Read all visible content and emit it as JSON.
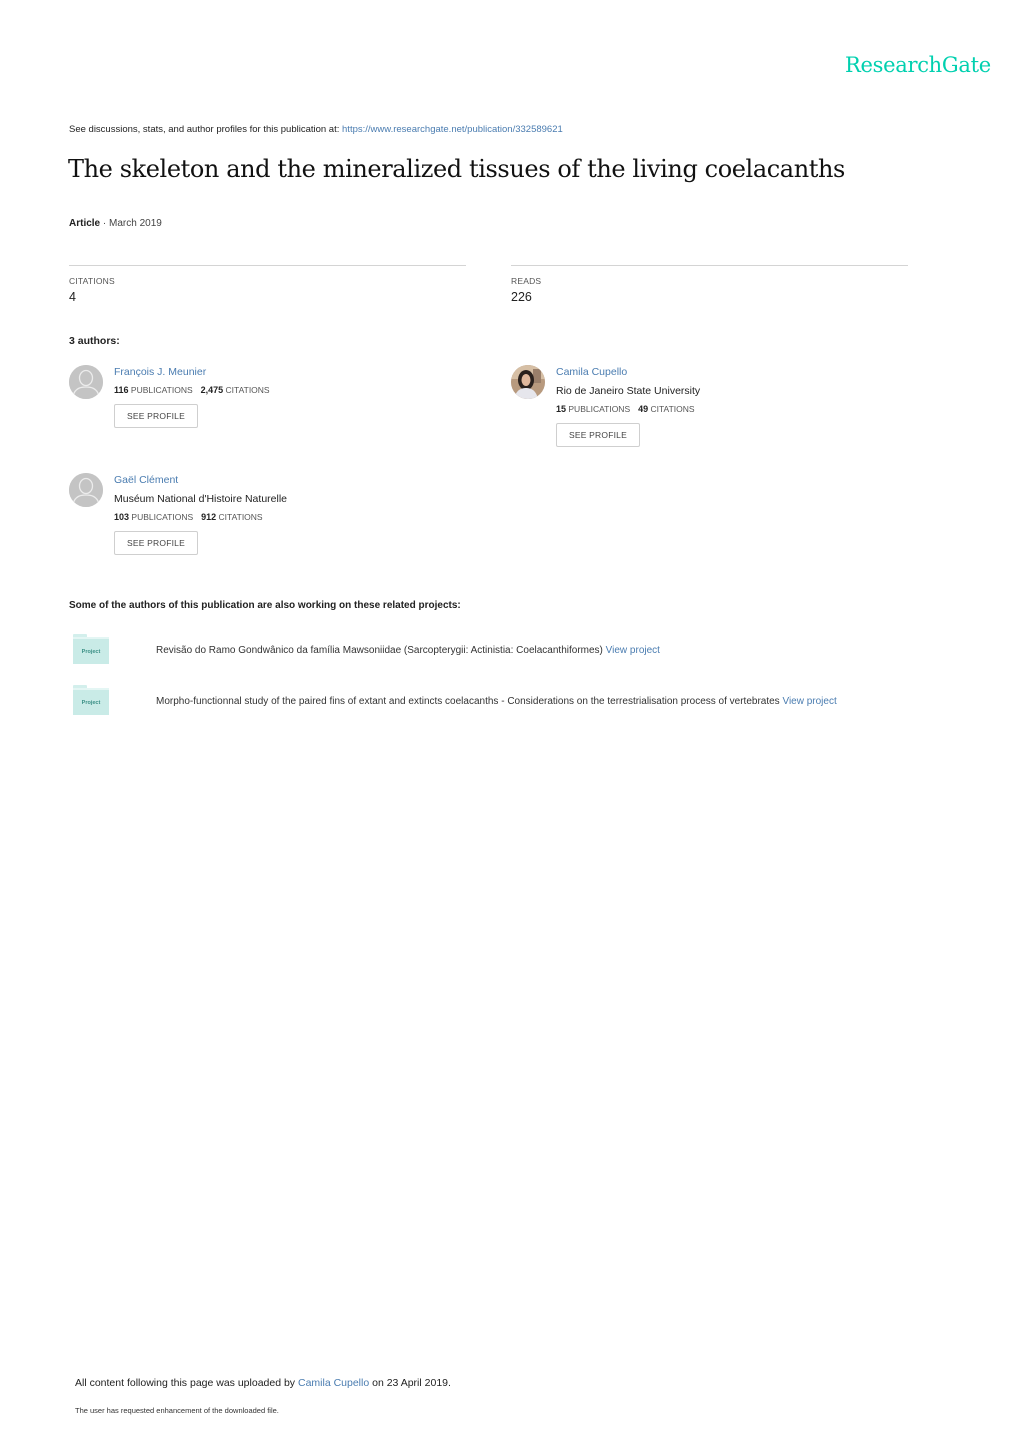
{
  "brand": {
    "logo_text": "ResearchGate",
    "logo_color": "#00d0af",
    "link_color": "#4a7cb0"
  },
  "header": {
    "discussions_prefix": "See discussions, stats, and author profiles for this publication at: ",
    "publication_url": "https://www.researchgate.net/publication/332589621"
  },
  "publication": {
    "title": "The skeleton and the mineralized tissues of the living coelacanths",
    "type": "Article",
    "separator": " · ",
    "date": "March 2019"
  },
  "stats": {
    "citations": {
      "label": "CITATIONS",
      "value": "4"
    },
    "reads": {
      "label": "READS",
      "value": "226"
    }
  },
  "authors_heading": "3 authors:",
  "authors": [
    {
      "name": "François J. Meunier",
      "institution": "",
      "publications": "116",
      "publications_label": "PUBLICATIONS",
      "citations": "2,475",
      "citations_label": "CITATIONS",
      "button": "SEE PROFILE",
      "avatar": "default-user-icon"
    },
    {
      "name": "Camila Cupello",
      "institution": "Rio de Janeiro State University",
      "publications": "15",
      "publications_label": "PUBLICATIONS",
      "citations": "49",
      "citations_label": "CITATIONS",
      "button": "SEE PROFILE",
      "avatar": "profile-photo"
    },
    {
      "name": "Gaël Clément",
      "institution": "Muséum National d'Histoire Naturelle",
      "publications": "103",
      "publications_label": "PUBLICATIONS",
      "citations": "912",
      "citations_label": "CITATIONS",
      "button": "SEE PROFILE",
      "avatar": "default-user-icon"
    }
  ],
  "related": {
    "heading": "Some of the authors of this publication are also working on these related projects:",
    "projects": [
      {
        "icon_label": "Project",
        "title": "Revisão do Ramo Gondwânico da família Mawsoniidae (Sarcopterygii: Actinistia: Coelacanthiformes) ",
        "link": "View project"
      },
      {
        "icon_label": "Project",
        "title": "Morpho-functionnal study of the paired fins of extant and extincts coelacanths - Considerations on the terrestrialisation process of vertebrates ",
        "link": "View project"
      }
    ]
  },
  "footer": {
    "uploaded_prefix": "All content following this page was uploaded by ",
    "uploader": "Camila Cupello",
    "uploaded_suffix": " on 23 April 2019.",
    "enhancement_note": "The user has requested enhancement of the downloaded file."
  }
}
